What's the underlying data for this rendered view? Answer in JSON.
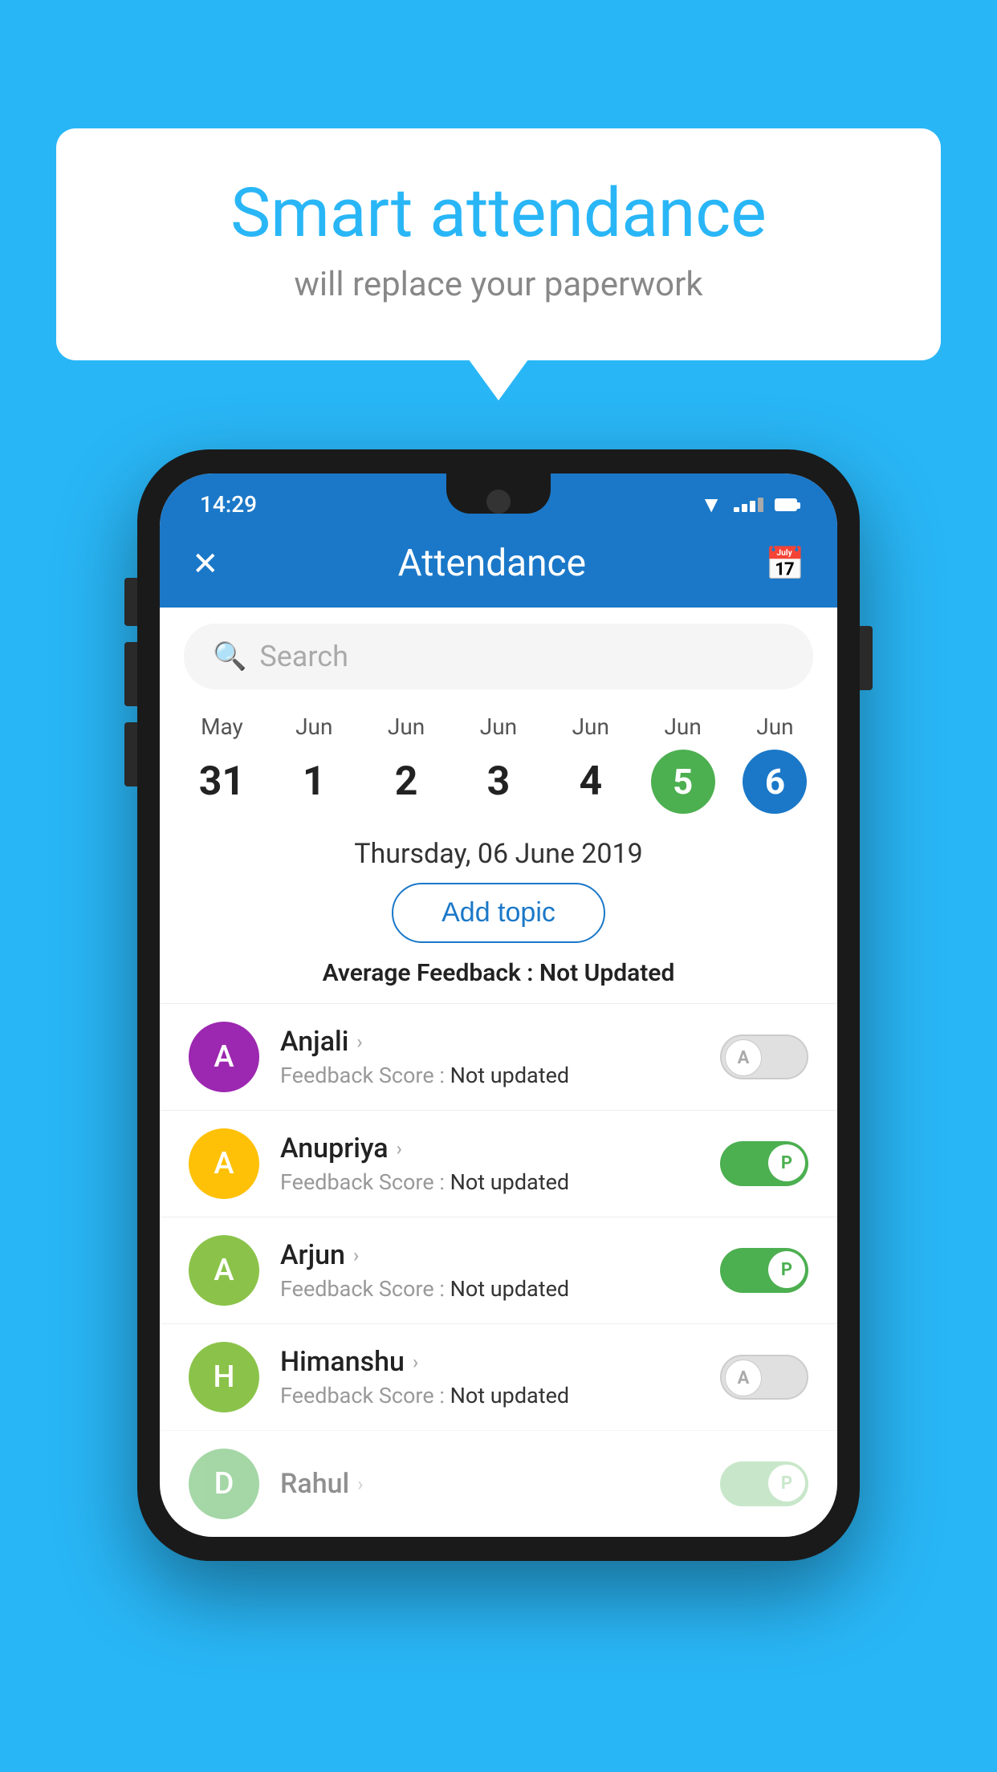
{
  "background_color": "#29B6F6",
  "speech_bubble": {
    "title": "Smart attendance",
    "subtitle": "will replace your paperwork"
  },
  "status_bar": {
    "time": "14:29"
  },
  "app_bar": {
    "title": "Attendance",
    "close_label": "✕",
    "calendar_label": "📅"
  },
  "search": {
    "placeholder": "Search"
  },
  "calendar": {
    "days": [
      {
        "month": "May",
        "date": "31",
        "style": "normal"
      },
      {
        "month": "Jun",
        "date": "1",
        "style": "normal"
      },
      {
        "month": "Jun",
        "date": "2",
        "style": "normal"
      },
      {
        "month": "Jun",
        "date": "3",
        "style": "normal"
      },
      {
        "month": "Jun",
        "date": "4",
        "style": "normal"
      },
      {
        "month": "Jun",
        "date": "5",
        "style": "today"
      },
      {
        "month": "Jun",
        "date": "6",
        "style": "selected"
      }
    ],
    "selected_date_label": "Thursday, 06 June 2019"
  },
  "add_topic_btn": "Add topic",
  "avg_feedback": {
    "label": "Average Feedback : ",
    "value": "Not Updated"
  },
  "students": [
    {
      "name": "Anjali",
      "feedback_label": "Feedback Score : ",
      "feedback_value": "Not updated",
      "avatar_letter": "A",
      "avatar_color": "#9C27B0",
      "toggle_state": "off",
      "toggle_letter": "A"
    },
    {
      "name": "Anupriya",
      "feedback_label": "Feedback Score : ",
      "feedback_value": "Not updated",
      "avatar_letter": "A",
      "avatar_color": "#FFC107",
      "toggle_state": "on",
      "toggle_letter": "P"
    },
    {
      "name": "Arjun",
      "feedback_label": "Feedback Score : ",
      "feedback_value": "Not updated",
      "avatar_letter": "A",
      "avatar_color": "#8BC34A",
      "toggle_state": "on",
      "toggle_letter": "P"
    },
    {
      "name": "Himanshu",
      "feedback_label": "Feedback Score : ",
      "feedback_value": "Not updated",
      "avatar_letter": "H",
      "avatar_color": "#8BC34A",
      "toggle_state": "off",
      "toggle_letter": "A"
    }
  ]
}
